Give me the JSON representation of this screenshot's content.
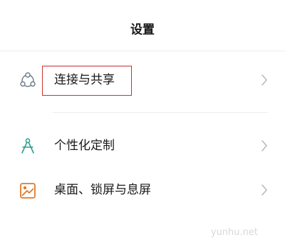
{
  "header": {
    "title": "设置"
  },
  "items": [
    {
      "label": "连接与共享",
      "icon": "share-connect-icon",
      "highlighted": true
    },
    {
      "label": "个性化定制",
      "icon": "compass-icon",
      "highlighted": false
    },
    {
      "label": "桌面、锁屏与息屏",
      "icon": "wallpaper-icon",
      "highlighted": false
    }
  ],
  "watermark": "yunhu.net",
  "colors": {
    "highlight_border": "#c83232",
    "share_icon": "#6b7b8c",
    "compass_icon": "#2a9d8f",
    "wallpaper_icon": "#e07a2a",
    "chevron": "#b5b5b5"
  }
}
